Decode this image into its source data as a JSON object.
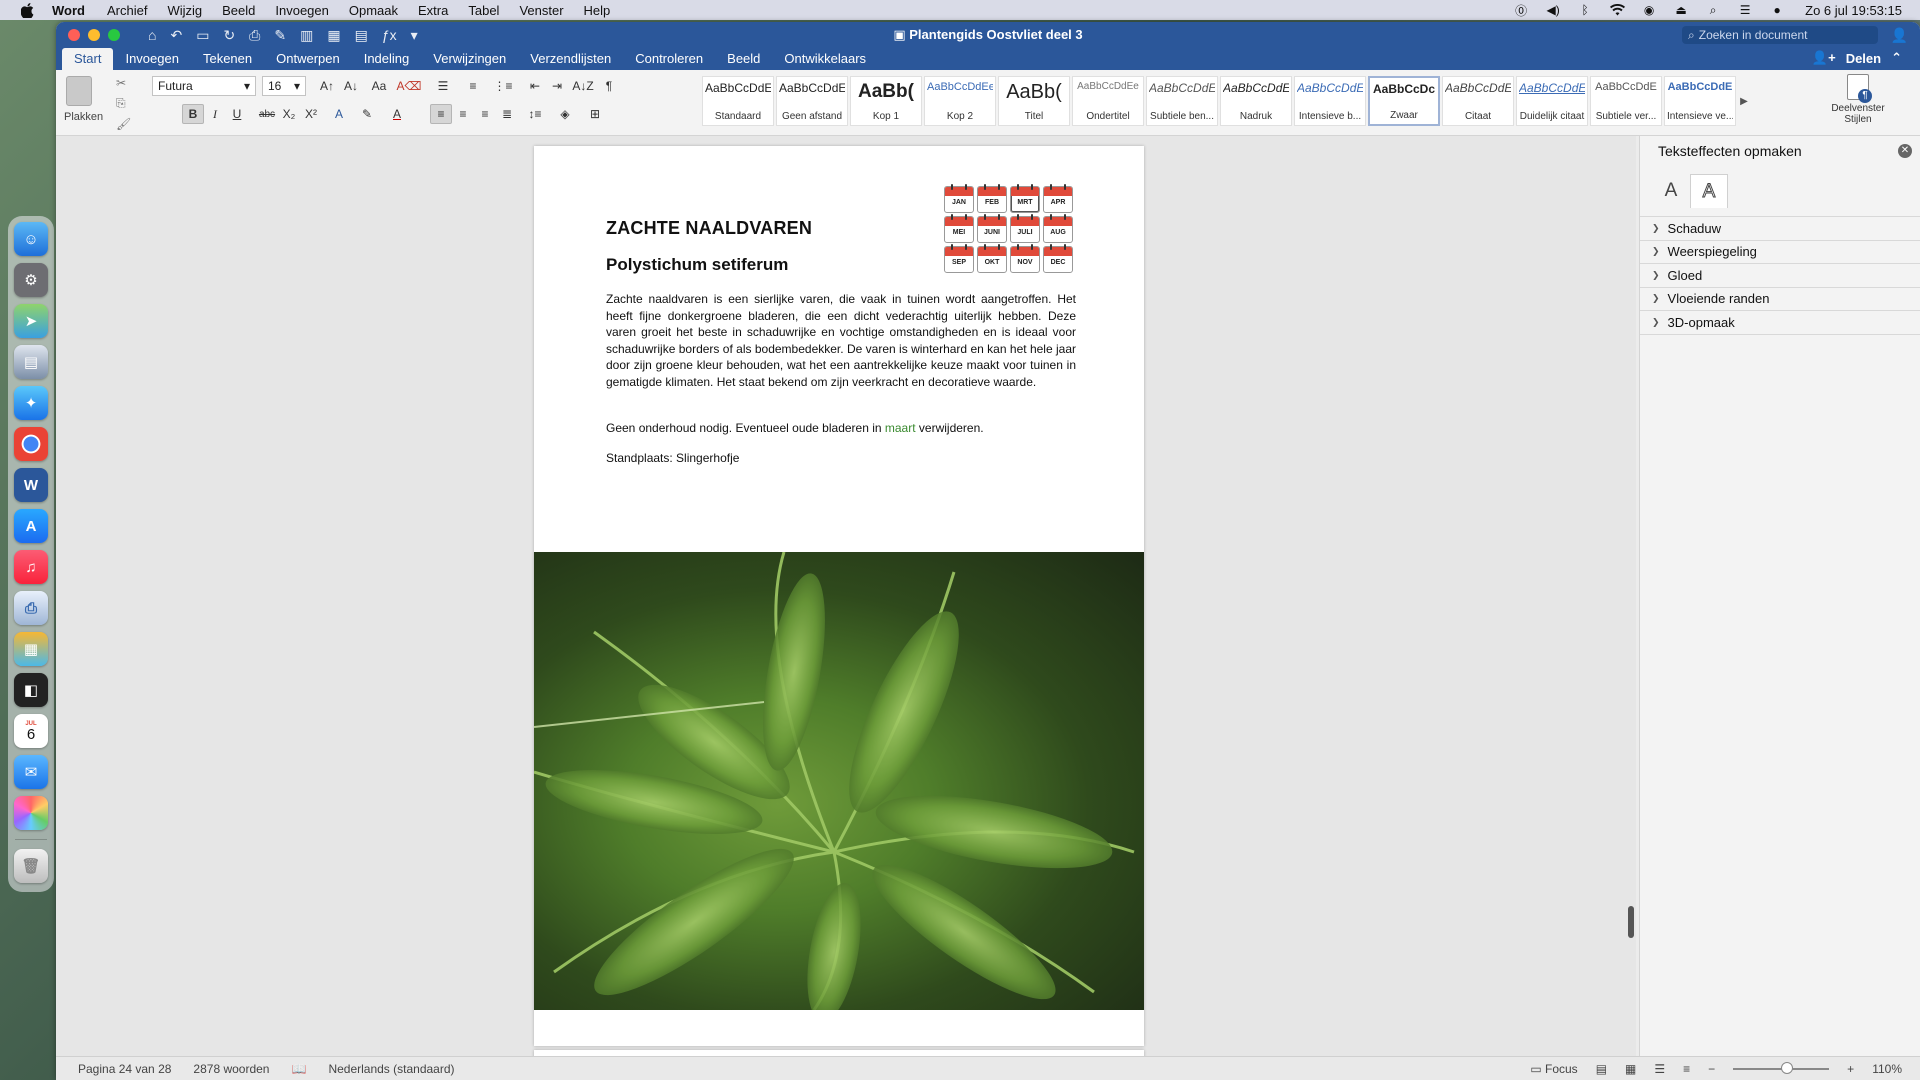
{
  "menubar": {
    "app_name": "Word",
    "items": [
      "Archief",
      "Wijzig",
      "Beeld",
      "Invoegen",
      "Opmaak",
      "Extra",
      "Tabel",
      "Venster",
      "Help"
    ],
    "clock": "Zo 6 jul  19:53:15"
  },
  "dock": {
    "calendar_month": "JUL",
    "calendar_day": "6"
  },
  "window": {
    "title": "Plantengids Oostvliet deel 3",
    "search_placeholder": "Zoeken in document",
    "share_label": "Delen",
    "tabs": [
      "Start",
      "Invoegen",
      "Tekenen",
      "Ontwerpen",
      "Indeling",
      "Verwijzingen",
      "Verzendlijsten",
      "Controleren",
      "Beeld",
      "Ontwikkelaars"
    ]
  },
  "ribbon": {
    "paste_label": "Plakken",
    "font_name": "Futura",
    "font_size": "16",
    "styles": [
      {
        "preview": "AaBbCcDdE",
        "label": "Standaard"
      },
      {
        "preview": "AaBbCcDdE",
        "label": "Geen afstand"
      },
      {
        "preview": "AaBb(",
        "label": "Kop 1"
      },
      {
        "preview": "AaBbCcDdEe",
        "label": "Kop 2"
      },
      {
        "preview": "AaBb(",
        "label": "Titel"
      },
      {
        "preview": "AaBbCcDdEe",
        "label": "Ondertitel"
      },
      {
        "preview": "AaBbCcDdE",
        "label": "Subtiele ben..."
      },
      {
        "preview": "AaBbCcDdE",
        "label": "Nadruk"
      },
      {
        "preview": "AaBbCcDdE",
        "label": "Intensieve b..."
      },
      {
        "preview": "AaBbCcDc",
        "label": "Zwaar"
      },
      {
        "preview": "AaBbCcDdE",
        "label": "Citaat"
      },
      {
        "preview": "AaBbCcDdE",
        "label": "Duidelijk citaat"
      },
      {
        "preview": "AaBbCcDdE",
        "label": "Subtiele ver..."
      },
      {
        "preview": "AaBbCcDdE",
        "label": "Intensieve ve..."
      }
    ],
    "styles_pane_label": "Deelvenster Stijlen"
  },
  "document": {
    "heading": "ZACHTE NAALDVAREN",
    "subheading": "Polystichum setiferum",
    "body": "Zachte naaldvaren is een sierlijke varen, die vaak in tuinen wordt aangetroffen. Het heeft fijne donkergroene bladeren, die een dicht vederachtig uiterlijk hebben. Deze varen groeit het beste in schaduwrijke en vochtige omstandigheden en is ideaal voor schaduwrijke borders of als bodembedekker. De varen is winterhard en kan het hele jaar door zijn groene kleur behouden, wat het een aantrekkelijke keuze maakt voor tuinen in gematigde klimaten. Het staat bekend om zijn veerkracht en decoratieve waarde.",
    "note_before": "Geen onderhoud nodig. Eventueel oude bladeren in ",
    "note_highlight": "maart",
    "note_after": " verwijderen.",
    "place": "Standplaats: Slingerhofje",
    "months": [
      "JAN",
      "FEB",
      "MRT",
      "APR",
      "MEI",
      "JUNI",
      "JULI",
      "AUG",
      "SEP",
      "OKT",
      "NOV",
      "DEC"
    ],
    "highlight_color": "#3a8a2f"
  },
  "sidepane": {
    "title": "Teksteffecten opmaken",
    "tab_fill": "A",
    "tab_effects": "A",
    "sections": [
      "Schaduw",
      "Weerspiegeling",
      "Gloed",
      "Vloeiende randen",
      "3D-opmaak"
    ]
  },
  "statusbar": {
    "page": "Pagina 24 van 28",
    "words": "2878 woorden",
    "language": "Nederlands (standaard)",
    "focus": "Focus",
    "zoom": "110%"
  },
  "colors": {
    "word_blue": "#2b579a",
    "calendar_red": "#e04a3a"
  }
}
